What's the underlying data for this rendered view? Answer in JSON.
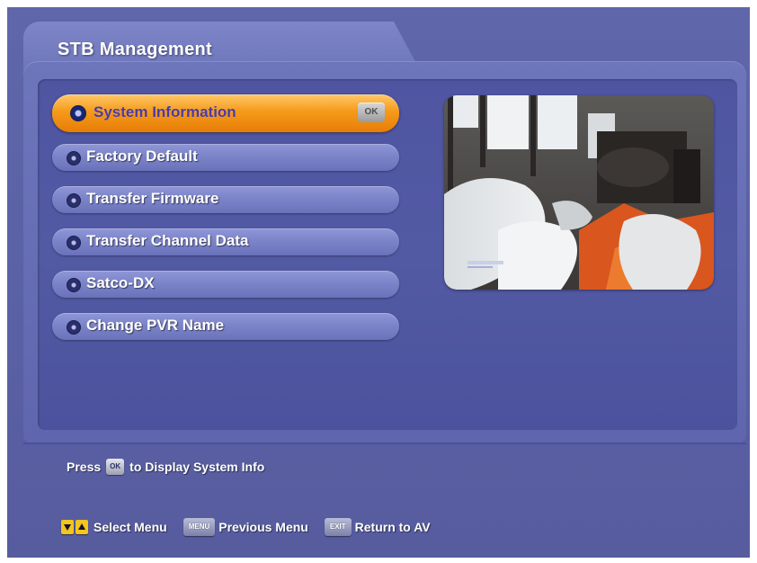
{
  "header": {
    "title": "STB Management"
  },
  "menu": {
    "items": [
      {
        "label": "System Information",
        "selected": true,
        "ok_label": "OK"
      },
      {
        "label": "Factory Default"
      },
      {
        "label": "Transfer Firmware"
      },
      {
        "label": "Transfer Channel Data"
      },
      {
        "label": "Satco-DX"
      },
      {
        "label": "Change PVR Name"
      }
    ]
  },
  "help": {
    "prefix": "Press",
    "key": "OK",
    "suffix": "to Display System Info"
  },
  "footer": {
    "select_label": "Select Menu",
    "menu_key": "MENU",
    "menu_label": "Previous Menu",
    "exit_key": "EXIT",
    "exit_label": "Return to AV"
  },
  "colors": {
    "background": "#5a60a4",
    "selected_item": "#f59a1a",
    "menu_item": "#7880c6",
    "arrow_key": "#f3c51d"
  },
  "icons": [
    "radio-bullet-icon",
    "arrow-down-icon",
    "arrow-up-icon"
  ]
}
